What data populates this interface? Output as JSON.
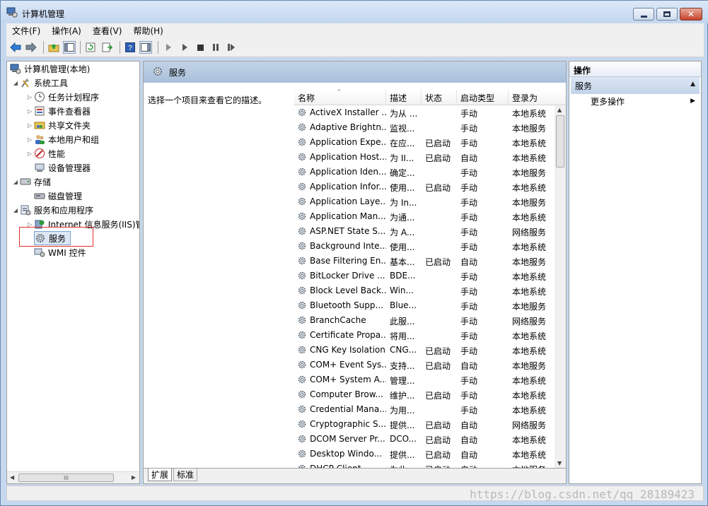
{
  "window": {
    "title": "计算机管理"
  },
  "menu": {
    "items": [
      "文件(F)",
      "操作(A)",
      "查看(V)",
      "帮助(H)"
    ]
  },
  "tree": {
    "items": [
      {
        "label": "计算机管理(本地)"
      },
      {
        "label": "系统工具"
      },
      {
        "label": "任务计划程序"
      },
      {
        "label": "事件查看器"
      },
      {
        "label": "共享文件夹"
      },
      {
        "label": "本地用户和组"
      },
      {
        "label": "性能"
      },
      {
        "label": "设备管理器"
      },
      {
        "label": "存储"
      },
      {
        "label": "磁盘管理"
      },
      {
        "label": "服务和应用程序"
      },
      {
        "label": "Internet 信息服务(IIS)管"
      },
      {
        "label": "服务"
      },
      {
        "label": "WMI 控件"
      }
    ],
    "scroll_label": "III"
  },
  "center": {
    "header_title": "服务",
    "description": "选择一个项目来查看它的描述。",
    "columns": [
      "名称",
      "描述",
      "状态",
      "启动类型",
      "登录为"
    ],
    "rows": [
      [
        "ActiveX Installer ...",
        "为从 ...",
        "",
        "手动",
        "本地系统"
      ],
      [
        "Adaptive Brightn...",
        "监视...",
        "",
        "手动",
        "本地服务"
      ],
      [
        "Application Expe...",
        "在应...",
        "已启动",
        "手动",
        "本地系统"
      ],
      [
        "Application Host...",
        "为 II...",
        "已启动",
        "自动",
        "本地系统"
      ],
      [
        "Application Iden...",
        "确定...",
        "",
        "手动",
        "本地服务"
      ],
      [
        "Application Infor...",
        "使用...",
        "已启动",
        "手动",
        "本地系统"
      ],
      [
        "Application Laye...",
        "为 In...",
        "",
        "手动",
        "本地服务"
      ],
      [
        "Application Man...",
        "为通...",
        "",
        "手动",
        "本地系统"
      ],
      [
        "ASP.NET State S...",
        "为 A...",
        "",
        "手动",
        "网络服务"
      ],
      [
        "Background Inte...",
        "使用...",
        "",
        "手动",
        "本地系统"
      ],
      [
        "Base Filtering En...",
        "基本...",
        "已启动",
        "自动",
        "本地服务"
      ],
      [
        "BitLocker Drive ...",
        "BDE...",
        "",
        "手动",
        "本地系统"
      ],
      [
        "Block Level Back...",
        "Win...",
        "",
        "手动",
        "本地系统"
      ],
      [
        "Bluetooth Supp...",
        "Blue...",
        "",
        "手动",
        "本地服务"
      ],
      [
        "BranchCache",
        "此服...",
        "",
        "手动",
        "网络服务"
      ],
      [
        "Certificate Propa...",
        "将用...",
        "",
        "手动",
        "本地系统"
      ],
      [
        "CNG Key Isolation",
        "CNG...",
        "已启动",
        "手动",
        "本地系统"
      ],
      [
        "COM+ Event Sys...",
        "支持...",
        "已启动",
        "自动",
        "本地服务"
      ],
      [
        "COM+ System A...",
        "管理...",
        "",
        "手动",
        "本地系统"
      ],
      [
        "Computer Brow...",
        "维护...",
        "已启动",
        "手动",
        "本地系统"
      ],
      [
        "Credential Mana...",
        "为用...",
        "",
        "手动",
        "本地系统"
      ],
      [
        "Cryptographic S...",
        "提供...",
        "已启动",
        "自动",
        "网络服务"
      ],
      [
        "DCOM Server Pr...",
        "DCO...",
        "已启动",
        "自动",
        "本地系统"
      ],
      [
        "Desktop Windo...",
        "提供...",
        "已启动",
        "自动",
        "本地系统"
      ],
      [
        "DHCP Client",
        "为此...",
        "已启动",
        "自动",
        "本地服务"
      ]
    ],
    "tabs": [
      "扩展",
      "标准"
    ]
  },
  "actions": {
    "header": "操作",
    "section": "服务",
    "more": "更多操作"
  },
  "watermark": "https://blog.csdn.net/qq_28189423"
}
